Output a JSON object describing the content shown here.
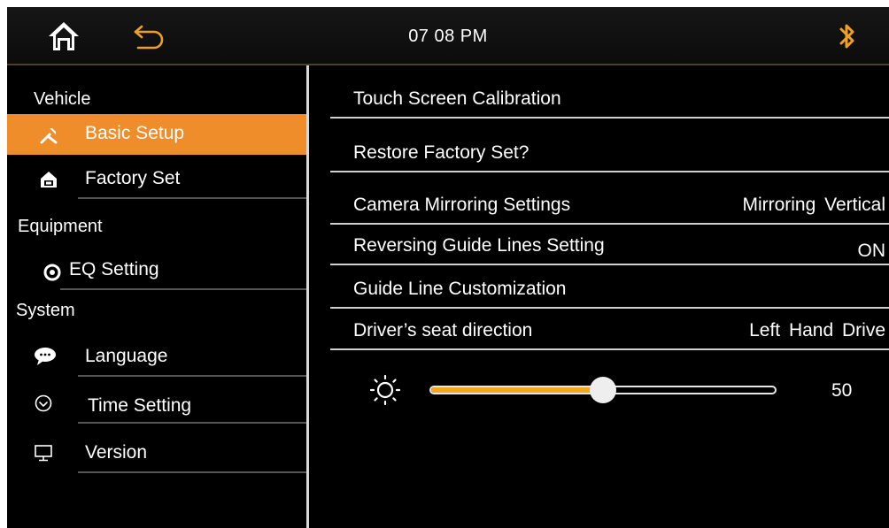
{
  "topbar": {
    "time": "07 08  PM",
    "home_icon": "home-icon",
    "back_icon": "back-arrow-icon",
    "bluetooth_icon": "bluetooth-icon",
    "accent": "#f0a020"
  },
  "sidebar": {
    "sections": [
      {
        "title": "Vehicle",
        "items": [
          {
            "label": "Basic Setup",
            "icon": "wrench-icon",
            "active": true
          },
          {
            "label": "Factory Set",
            "icon": "factory-house-icon",
            "active": false
          }
        ]
      },
      {
        "title": "Equipment",
        "items": [
          {
            "label": "EQ Setting",
            "icon": "eq-icon",
            "active": false
          }
        ]
      },
      {
        "title": "System",
        "items": [
          {
            "label": "Language",
            "icon": "speech-bubble-icon",
            "active": false
          },
          {
            "label": "Time Setting",
            "icon": "clock-icon",
            "active": false
          },
          {
            "label": "Version",
            "icon": "monitor-icon",
            "active": false
          }
        ]
      }
    ],
    "active_color": "#ee8d2a"
  },
  "main": {
    "rows": [
      {
        "label": "Touch Screen Calibration",
        "value": ""
      },
      {
        "label": "Restore Factory Set?",
        "value": ""
      },
      {
        "label": "Camera Mirroring Settings",
        "value": "Mirroring  Vertical"
      },
      {
        "label": "Reversing Guide Lines Setting",
        "value": "ON"
      },
      {
        "label": "Guide Line Customization",
        "value": ""
      },
      {
        "label": "Driver’s seat direction",
        "value": "Left Hand Drive"
      }
    ],
    "brightness": {
      "icon": "brightness-sun-icon",
      "value": "50",
      "level": 0.5,
      "fill_color": "#f2a81c"
    }
  }
}
